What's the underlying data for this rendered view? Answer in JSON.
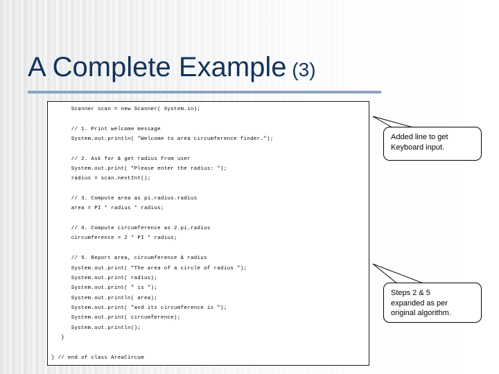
{
  "slide": {
    "title_main": "A Complete Example",
    "title_suffix": "(3)",
    "accent_color": "#12335c",
    "rule_color": "#8ba3bf"
  },
  "code_block": {
    "language": "java",
    "lines": [
      "      Scanner scan = new Scanner( System.in);",
      "",
      "      // 1. Print welcome message",
      "      System.out.println( \"Welcome to area circumference finder.\");",
      "",
      "      // 2. Ask for & get radius from user",
      "      System.out.print( \"Please enter the radius: \");",
      "      radius = scan.nextInt();",
      "",
      "      // 3. Compute area as pi.radius.radius",
      "      area = PI * radius * radius;",
      "",
      "      // 4. Compute circumference as 2.pi.radius",
      "      circumference = 2 * PI * radius;",
      "",
      "      // 5. Report area, circumference & radius",
      "      System.out.print( \"The area of a circle of radius \");",
      "      System.out.print( radius);",
      "      System.out.print( \" is \");",
      "      System.out.println( area);",
      "      System.out.print( \"and its circumference is \");",
      "      System.out.print( circumference);",
      "      System.out.println();",
      "   }",
      "",
      "} // end of class AreaCircum"
    ]
  },
  "callouts": [
    {
      "id": "added-line",
      "lines": [
        "Added line to get",
        "Keyboard input."
      ]
    },
    {
      "id": "steps-expanded",
      "lines": [
        "Steps 2 & 5",
        "expanded as per",
        "original algorithm."
      ]
    }
  ]
}
